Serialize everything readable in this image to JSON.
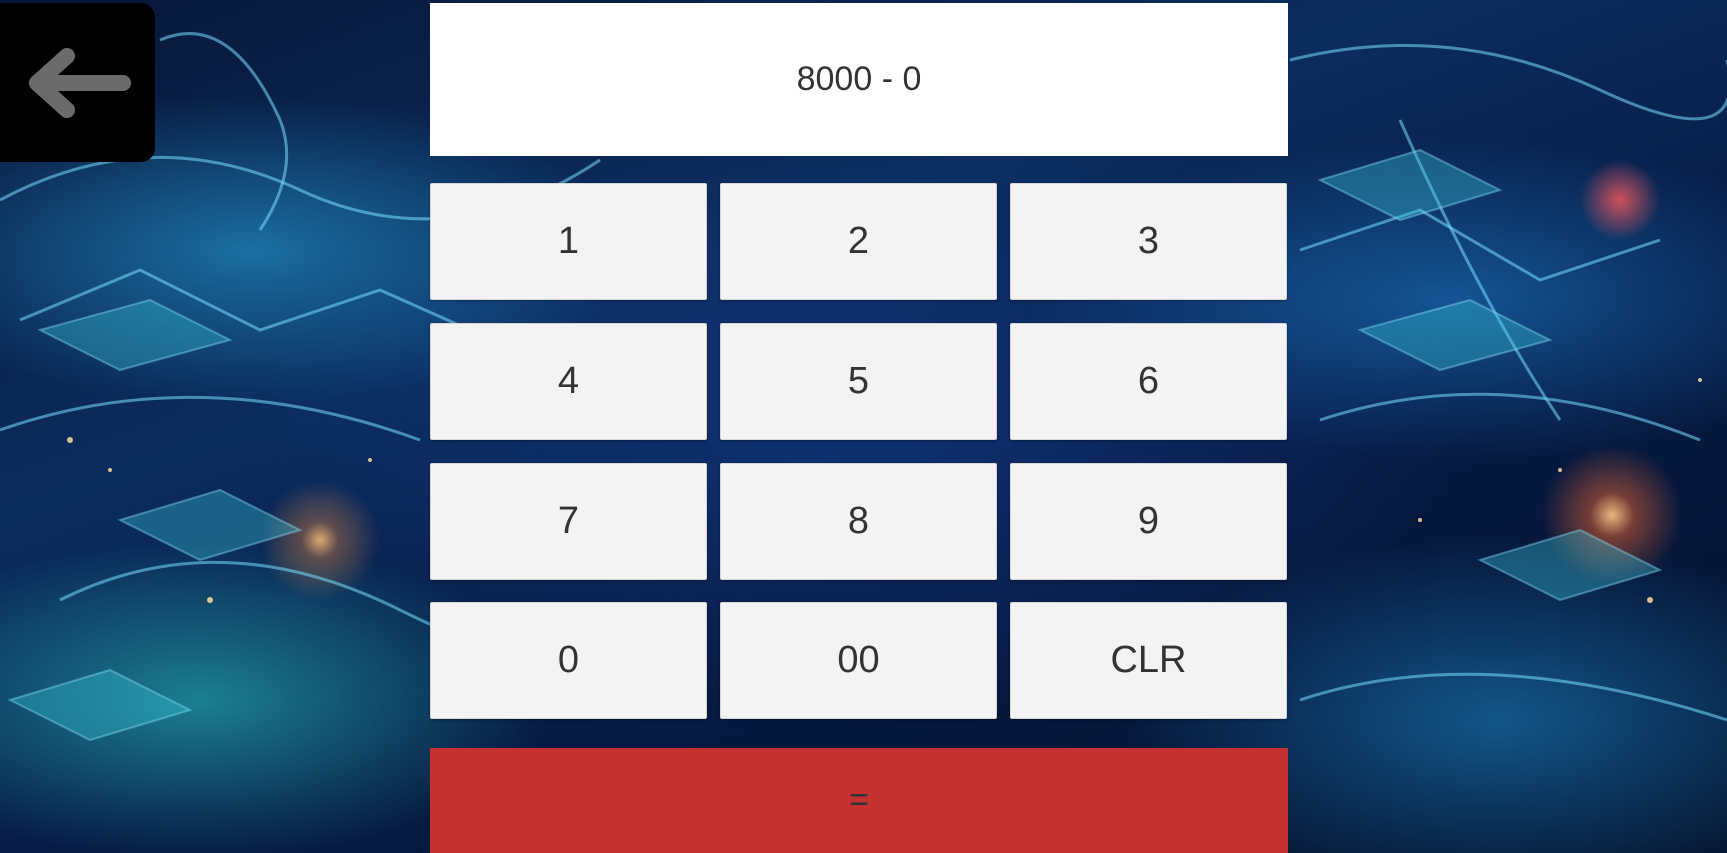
{
  "display": {
    "expression": "8000 - 0"
  },
  "back_button": {
    "icon": "arrow-left-icon",
    "color": "#000000"
  },
  "keys": [
    {
      "label": "1",
      "name": "key-1"
    },
    {
      "label": "2",
      "name": "key-2"
    },
    {
      "label": "3",
      "name": "key-3"
    },
    {
      "label": "4",
      "name": "key-4"
    },
    {
      "label": "5",
      "name": "key-5"
    },
    {
      "label": "6",
      "name": "key-6"
    },
    {
      "label": "7",
      "name": "key-7"
    },
    {
      "label": "8",
      "name": "key-8"
    },
    {
      "label": "9",
      "name": "key-9"
    },
    {
      "label": "0",
      "name": "key-0"
    },
    {
      "label": "00",
      "name": "key-00"
    },
    {
      "label": "CLR",
      "name": "clear-button"
    }
  ],
  "equals": {
    "label": "=",
    "color": "#c43130"
  },
  "colors": {
    "key_background": "#f3f3f3",
    "display_background": "#ffffff"
  }
}
